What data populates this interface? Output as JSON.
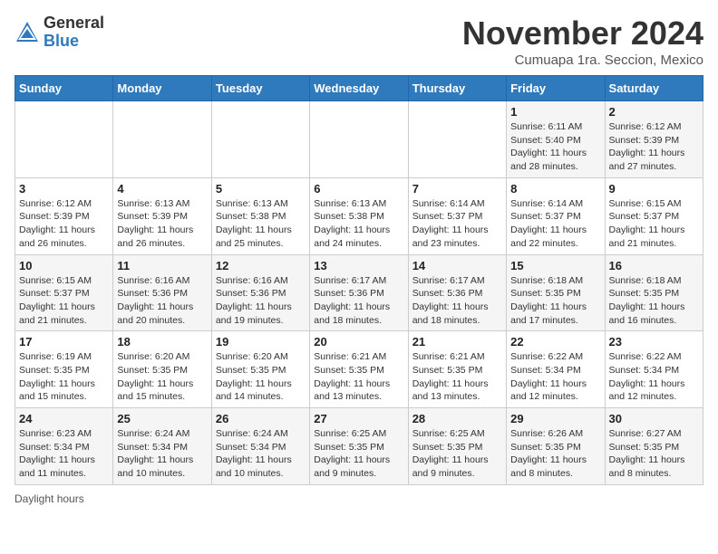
{
  "header": {
    "logo_general": "General",
    "logo_blue": "Blue",
    "month_title": "November 2024",
    "location": "Cumuapa 1ra. Seccion, Mexico"
  },
  "weekdays": [
    "Sunday",
    "Monday",
    "Tuesday",
    "Wednesday",
    "Thursday",
    "Friday",
    "Saturday"
  ],
  "weeks": [
    [
      {
        "day": "",
        "info": ""
      },
      {
        "day": "",
        "info": ""
      },
      {
        "day": "",
        "info": ""
      },
      {
        "day": "",
        "info": ""
      },
      {
        "day": "",
        "info": ""
      },
      {
        "day": "1",
        "info": "Sunrise: 6:11 AM\nSunset: 5:40 PM\nDaylight: 11 hours and 28 minutes."
      },
      {
        "day": "2",
        "info": "Sunrise: 6:12 AM\nSunset: 5:39 PM\nDaylight: 11 hours and 27 minutes."
      }
    ],
    [
      {
        "day": "3",
        "info": "Sunrise: 6:12 AM\nSunset: 5:39 PM\nDaylight: 11 hours and 26 minutes."
      },
      {
        "day": "4",
        "info": "Sunrise: 6:13 AM\nSunset: 5:39 PM\nDaylight: 11 hours and 26 minutes."
      },
      {
        "day": "5",
        "info": "Sunrise: 6:13 AM\nSunset: 5:38 PM\nDaylight: 11 hours and 25 minutes."
      },
      {
        "day": "6",
        "info": "Sunrise: 6:13 AM\nSunset: 5:38 PM\nDaylight: 11 hours and 24 minutes."
      },
      {
        "day": "7",
        "info": "Sunrise: 6:14 AM\nSunset: 5:37 PM\nDaylight: 11 hours and 23 minutes."
      },
      {
        "day": "8",
        "info": "Sunrise: 6:14 AM\nSunset: 5:37 PM\nDaylight: 11 hours and 22 minutes."
      },
      {
        "day": "9",
        "info": "Sunrise: 6:15 AM\nSunset: 5:37 PM\nDaylight: 11 hours and 21 minutes."
      }
    ],
    [
      {
        "day": "10",
        "info": "Sunrise: 6:15 AM\nSunset: 5:37 PM\nDaylight: 11 hours and 21 minutes."
      },
      {
        "day": "11",
        "info": "Sunrise: 6:16 AM\nSunset: 5:36 PM\nDaylight: 11 hours and 20 minutes."
      },
      {
        "day": "12",
        "info": "Sunrise: 6:16 AM\nSunset: 5:36 PM\nDaylight: 11 hours and 19 minutes."
      },
      {
        "day": "13",
        "info": "Sunrise: 6:17 AM\nSunset: 5:36 PM\nDaylight: 11 hours and 18 minutes."
      },
      {
        "day": "14",
        "info": "Sunrise: 6:17 AM\nSunset: 5:36 PM\nDaylight: 11 hours and 18 minutes."
      },
      {
        "day": "15",
        "info": "Sunrise: 6:18 AM\nSunset: 5:35 PM\nDaylight: 11 hours and 17 minutes."
      },
      {
        "day": "16",
        "info": "Sunrise: 6:18 AM\nSunset: 5:35 PM\nDaylight: 11 hours and 16 minutes."
      }
    ],
    [
      {
        "day": "17",
        "info": "Sunrise: 6:19 AM\nSunset: 5:35 PM\nDaylight: 11 hours and 15 minutes."
      },
      {
        "day": "18",
        "info": "Sunrise: 6:20 AM\nSunset: 5:35 PM\nDaylight: 11 hours and 15 minutes."
      },
      {
        "day": "19",
        "info": "Sunrise: 6:20 AM\nSunset: 5:35 PM\nDaylight: 11 hours and 14 minutes."
      },
      {
        "day": "20",
        "info": "Sunrise: 6:21 AM\nSunset: 5:35 PM\nDaylight: 11 hours and 13 minutes."
      },
      {
        "day": "21",
        "info": "Sunrise: 6:21 AM\nSunset: 5:35 PM\nDaylight: 11 hours and 13 minutes."
      },
      {
        "day": "22",
        "info": "Sunrise: 6:22 AM\nSunset: 5:34 PM\nDaylight: 11 hours and 12 minutes."
      },
      {
        "day": "23",
        "info": "Sunrise: 6:22 AM\nSunset: 5:34 PM\nDaylight: 11 hours and 12 minutes."
      }
    ],
    [
      {
        "day": "24",
        "info": "Sunrise: 6:23 AM\nSunset: 5:34 PM\nDaylight: 11 hours and 11 minutes."
      },
      {
        "day": "25",
        "info": "Sunrise: 6:24 AM\nSunset: 5:34 PM\nDaylight: 11 hours and 10 minutes."
      },
      {
        "day": "26",
        "info": "Sunrise: 6:24 AM\nSunset: 5:34 PM\nDaylight: 11 hours and 10 minutes."
      },
      {
        "day": "27",
        "info": "Sunrise: 6:25 AM\nSunset: 5:35 PM\nDaylight: 11 hours and 9 minutes."
      },
      {
        "day": "28",
        "info": "Sunrise: 6:25 AM\nSunset: 5:35 PM\nDaylight: 11 hours and 9 minutes."
      },
      {
        "day": "29",
        "info": "Sunrise: 6:26 AM\nSunset: 5:35 PM\nDaylight: 11 hours and 8 minutes."
      },
      {
        "day": "30",
        "info": "Sunrise: 6:27 AM\nSunset: 5:35 PM\nDaylight: 11 hours and 8 minutes."
      }
    ]
  ],
  "footer": {
    "daylight_label": "Daylight hours"
  }
}
